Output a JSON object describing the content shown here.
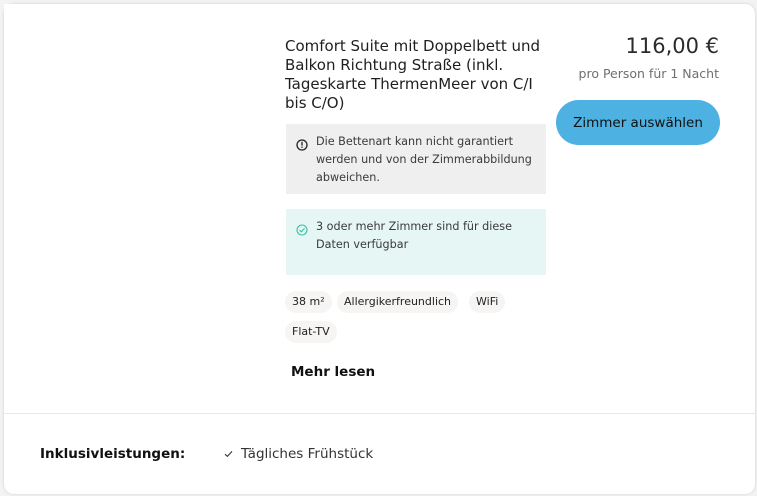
{
  "room": {
    "title": "Comfort Suite mit Doppelbett und Balkon Richtung Straße (inkl. Tageskarte ThermenMeer von C/I bis C/O)",
    "price": "116,00 €",
    "price_sub": "pro Person für 1 Nacht",
    "select_label": "Zimmer auswählen",
    "notice_bed": "Die Bettenart kann nicht garantiert werden und von der Zimmerabbildung abweichen.",
    "notice_availability": "3 oder mehr Zimmer sind für diese Daten verfügbar",
    "features": [
      "38 m²",
      "Allergikerfreundlich",
      "WiFi",
      "Flat-TV"
    ],
    "more_label": "Mehr lesen"
  },
  "inclusions": {
    "label": "Inklusivleistungen:",
    "items": [
      "Tägliches Frühstück"
    ]
  },
  "colors": {
    "accent": "#4db1e2",
    "availability_bg": "#e6f6f4",
    "availability_icon": "#3dbfa6",
    "notice_bg": "#efefef"
  },
  "icons": {
    "bed_notice": "info-circle-icon",
    "availability": "check-circle-icon",
    "inclusion": "checkmark-icon"
  }
}
